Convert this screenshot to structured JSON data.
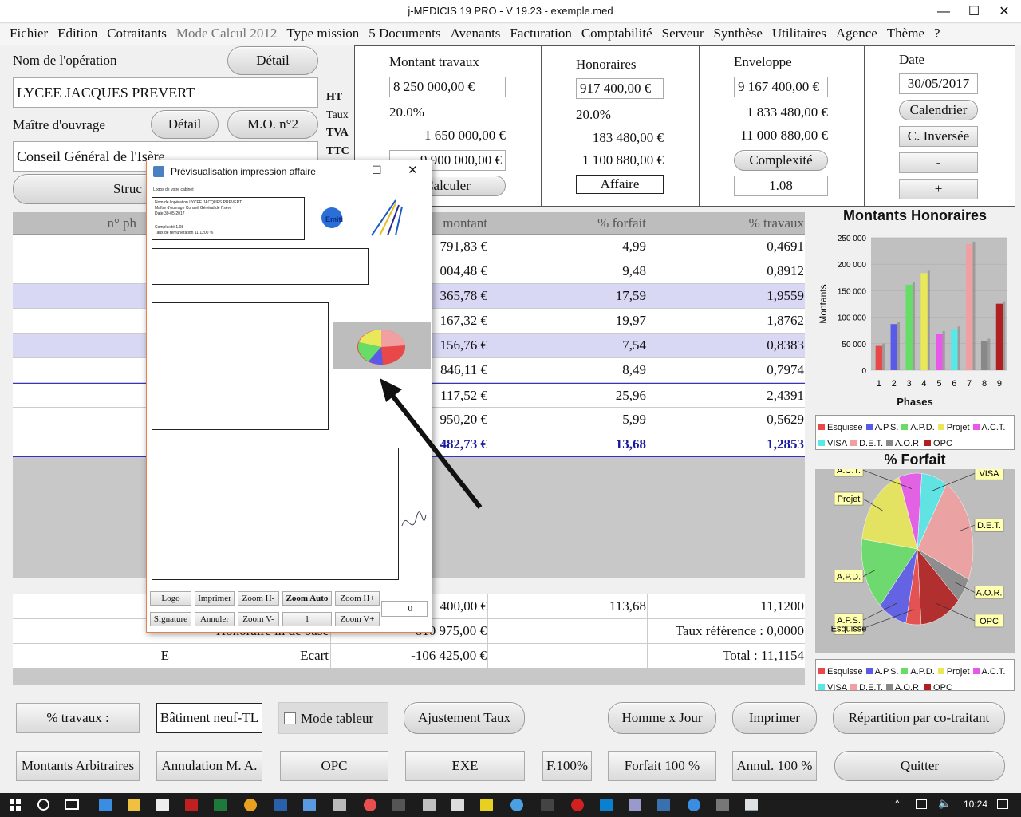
{
  "window": {
    "title": "j-MEDICIS 19 PRO - V 19.23 - exemple.med",
    "min": "—",
    "max": "☐",
    "close": "✕"
  },
  "menu": [
    "Fichier",
    "Edition",
    "Cotraitants",
    "Mode Calcul 2012",
    "Type mission",
    "5 Documents",
    "Avenants",
    "Facturation",
    "Comptabilité",
    "Serveur",
    "Synthèse",
    "Utilitaires",
    "Agence",
    "Thème",
    "?"
  ],
  "operation": {
    "label": "Nom de l'opération",
    "detail": "Détail",
    "value": "LYCEE JACQUES PREVERT"
  },
  "owner": {
    "label": "Maître d'ouvrage",
    "detail": "Détail",
    "mo2": "M.O. n°2",
    "value": "Conseil Général de l'Isère",
    "struct_btn": "Struc"
  },
  "rowlabels": {
    "ht": "HT",
    "taux": "Taux",
    "tva": "TVA",
    "ttc": "TTC"
  },
  "travaux": {
    "title": "Montant travaux",
    "ht": "8 250 000,00 €",
    "taux": "20.0%",
    "tva": "1 650 000,00 €",
    "ttc": "9 900 000,00 €",
    "calc": "Calculer"
  },
  "honoraires": {
    "title": "Honoraires",
    "ht": "917 400,00 €",
    "taux": "20.0%",
    "tva": "183 480,00 €",
    "ttc": "1 100 880,00 €",
    "affaire": "Affaire"
  },
  "enveloppe": {
    "title": "Enveloppe",
    "ht": "9 167 400,00 €",
    "tva": "1 833 480,00 €",
    "ttc": "11 000 880,00 €",
    "complexite": "Complexité",
    "coef": "1.08"
  },
  "date": {
    "label": "Date",
    "value": "30/05/2017",
    "cal": "Calendrier",
    "inv": "C. Inversée",
    "minus": "-",
    "plus": "+"
  },
  "grid": {
    "headers": [
      "n° ph",
      "montant",
      "% forfait",
      "% travaux"
    ],
    "rows": [
      [
        "791,83 €",
        "4,99",
        "0,4691"
      ],
      [
        "004,48 €",
        "9,48",
        "0,8912"
      ],
      [
        "365,78 €",
        "17,59",
        "1,9559"
      ],
      [
        "167,32 €",
        "19,97",
        "1,8762"
      ],
      [
        "156,76 €",
        "7,54",
        "0,8383"
      ],
      [
        "846,11 €",
        "8,49",
        "0,7974"
      ],
      [
        "117,52 €",
        "25,96",
        "2,4391"
      ],
      [
        "950,20 €",
        "5,99",
        "0,5629"
      ],
      [
        "482,73 €",
        "13,68",
        "1,2853"
      ]
    ]
  },
  "totals": {
    "r1": [
      "400,00 €",
      "113,68",
      "11,1200"
    ],
    "r2_label": "Honoraire in de base",
    "r2_val": "810 975,00 €",
    "r2_right": "Taux référence : 0,0000",
    "r3_left": "E",
    "r3_label": "Ecart",
    "r3_val": "-106 425,00 €",
    "r3_right": "Total : 11,1154"
  },
  "chart_data": [
    {
      "type": "bar",
      "title": "Montants Honoraires",
      "xlabel": "Phases",
      "ylabel": "Montants",
      "categories": [
        "1",
        "2",
        "3",
        "4",
        "5",
        "6",
        "7",
        "8",
        "9"
      ],
      "values": [
        45791,
        87004,
        161365,
        183167,
        69156,
        77846,
        238117,
        54950,
        125482
      ],
      "ylim": [
        0,
        250000
      ],
      "yticks": [
        "0",
        "50 000",
        "100 000",
        "150 000",
        "200 000",
        "250 000"
      ],
      "colors": [
        "#e84848",
        "#5a5ae8",
        "#66dd66",
        "#e8e858",
        "#e858e8",
        "#58e8e8",
        "#f0a0a0",
        "#888888",
        "#b02020"
      ],
      "legend": [
        "Esquisse",
        "A.P.S.",
        "A.P.D.",
        "Projet",
        "A.C.T.",
        "VISA",
        "D.E.T.",
        "A.O.R.",
        "OPC"
      ]
    },
    {
      "type": "pie",
      "title": "% Forfait",
      "categories": [
        "Esquisse",
        "A.P.S.",
        "A.P.D.",
        "Projet",
        "A.C.T.",
        "VISA",
        "D.E.T.",
        "A.O.R.",
        "OPC"
      ],
      "values": [
        4.99,
        9.48,
        17.59,
        19.97,
        7.54,
        8.49,
        25.96,
        5.99,
        13.68
      ],
      "colors": [
        "#e84848",
        "#5a5ae8",
        "#66dd66",
        "#e8e858",
        "#e858e8",
        "#58e8e8",
        "#f0a0a0",
        "#888888",
        "#b02020"
      ]
    }
  ],
  "preview": {
    "title": "Prévisualisation impression affaire",
    "lines": [
      "Logos de votre cabinet",
      "Nom de l'opération  LYCEE JACQUES PREVERT",
      "Maître d'ouvrage  Conseil Général de l'Isère",
      "Date  30-05-2017",
      "Complexité  1.08",
      "Taux de rémunération  11,1200 %"
    ],
    "logo": "Emiti Sarl",
    "buttons": [
      "Logo",
      "Imprimer",
      "Zoom H-",
      "Zoom Auto",
      "Zoom H+",
      "Signature",
      "Annuler",
      "Zoom V-",
      "1",
      "Zoom V+"
    ],
    "page": "0"
  },
  "bottom1": {
    "pct": "% travaux :",
    "type": "Bâtiment neuf-TL",
    "mode": "Mode tableur",
    "ajust": "Ajustement Taux",
    "hj": "Homme x Jour",
    "print": "Imprimer",
    "rep": "Répartition par co-traitant"
  },
  "bottom2": {
    "arb": "Montants Arbitraires",
    "annul": "Annulation M. A.",
    "opc": "OPC",
    "exe": "EXE",
    "f100": "F.100%",
    "forfait": "Forfait 100 %",
    "annul100": "Annul. 100 %",
    "quit": "Quitter"
  },
  "taskbar": {
    "time": "10:24"
  }
}
